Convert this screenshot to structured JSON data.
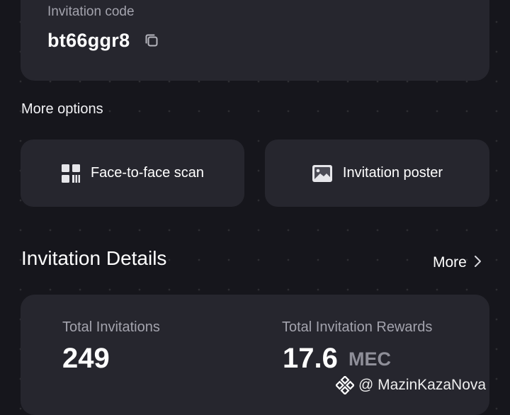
{
  "invitation": {
    "label": "Invitation code",
    "code": "bt66ggr8"
  },
  "more_options": {
    "title": "More options",
    "buttons": [
      {
        "label": "Face-to-face scan",
        "icon": "qr-code-icon"
      },
      {
        "label": "Invitation poster",
        "icon": "image-icon"
      }
    ]
  },
  "details": {
    "title": "Invitation Details",
    "more_label": "More",
    "total_invitations_label": "Total Invitations",
    "total_invitations_value": "249",
    "total_rewards_label": "Total Invitation Rewards",
    "total_rewards_value": "17.6",
    "total_rewards_unit": "MEC"
  },
  "watermark": {
    "text": "@ MazinKazaNova",
    "icon": "binance-logo-icon"
  },
  "colors": {
    "background": "#16161c",
    "card": "#26262e",
    "muted_text": "#a3a3ad",
    "unit_text": "#8f8f99"
  }
}
